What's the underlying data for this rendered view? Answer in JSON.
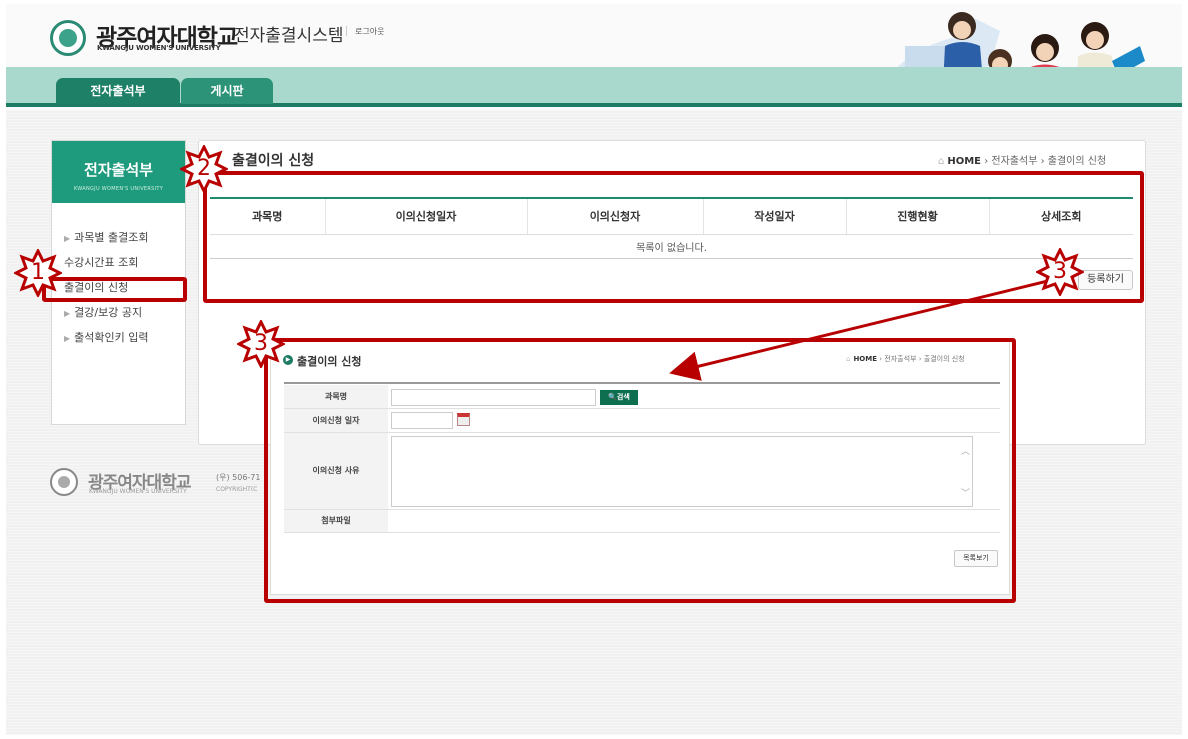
{
  "header": {
    "university_name": "광주여자대학교",
    "university_eng": "KWANGJU WOMEN'S UNIVERSITY",
    "system_name": "전자출결시스템",
    "logout_label": "로그아웃"
  },
  "nav": {
    "tabs": [
      {
        "label": "전자출석부"
      },
      {
        "label": "게시판"
      }
    ]
  },
  "sidebar": {
    "title": "전자출석부",
    "subtitle": "KWANGJU WOMEN'S UNIVERSITY",
    "items": [
      {
        "label": "과목별 출결조회"
      },
      {
        "label": "수강시간표 조회"
      },
      {
        "label": "출결이의 신청"
      },
      {
        "label": "결강/보강 공지"
      },
      {
        "label": "출석확인키 입력"
      }
    ]
  },
  "content": {
    "title": "출결이의 신청",
    "breadcrumb": {
      "home": "HOME",
      "level1": "전자출석부",
      "level2": "출결이의 신청"
    },
    "table": {
      "headers": [
        "과목명",
        "이의신청일자",
        "이의신청자",
        "작성일자",
        "진행현황",
        "상세조회"
      ],
      "empty_message": "목록이 없습니다."
    },
    "register_button": "등록하기"
  },
  "footer": {
    "university_name": "광주여자대학교",
    "university_eng": "KWANGJU WOMEN'S UNIVERSITY",
    "address": "(우) 506-71",
    "copyright": "COPYRIGHT(C"
  },
  "popup": {
    "title": "출결이의 신청",
    "breadcrumb": {
      "home": "HOME",
      "level1": "전자출석부",
      "level2": "출결이의 신청"
    },
    "fields": {
      "course_label": "과목명",
      "search_button": "검색",
      "date_label": "이의신청 일자",
      "reason_label": "이의신청 사유",
      "attachment_label": "첨부파일"
    },
    "list_button": "목록보기"
  },
  "annotations": {
    "labels": [
      "1",
      "2",
      "3",
      "3"
    ],
    "color": "#b80000"
  },
  "colors": {
    "brand_green": "#1e9a7c",
    "nav_band": "#a9d9cc",
    "search_button": "#0e6e50"
  }
}
